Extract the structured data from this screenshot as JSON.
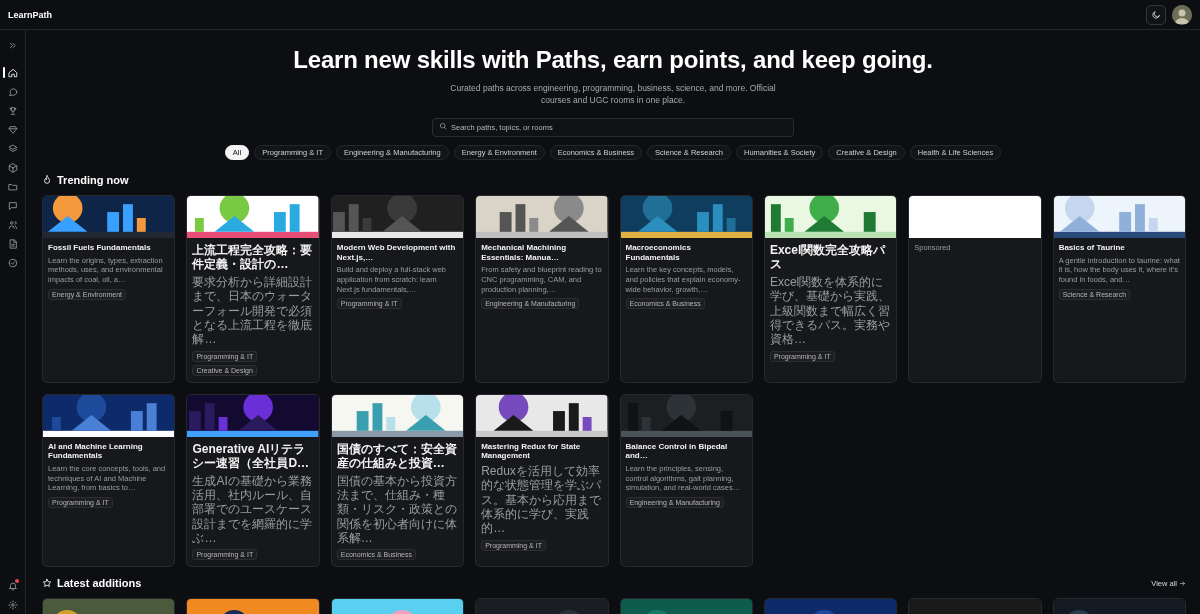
{
  "header": {
    "logo": "LearnPath"
  },
  "sidebar": {
    "items": [
      {
        "selected": true
      },
      {
        "selected": false
      },
      {
        "selected": false
      },
      {
        "selected": false
      },
      {
        "selected": false
      },
      {
        "selected": false
      },
      {
        "selected": false
      },
      {
        "selected": false
      },
      {
        "selected": false
      },
      {
        "selected": false
      },
      {
        "selected": false
      }
    ],
    "notifications_unread": true
  },
  "hero": {
    "title": "Learn new skills with Paths, earn points, and keep going.",
    "subtitle": "Curated paths across engineering, programming, business, science, and more. Official courses and UGC rooms in one place.",
    "search": {
      "placeholder": "Search paths, topics, or rooms"
    }
  },
  "filters": [
    {
      "label": "All",
      "selected": true
    },
    {
      "label": "Programming & IT",
      "selected": false
    },
    {
      "label": "Engineering & Manufacturing",
      "selected": false
    },
    {
      "label": "Energy & Environment",
      "selected": false
    },
    {
      "label": "Economics & Business",
      "selected": false
    },
    {
      "label": "Science & Research",
      "selected": false
    },
    {
      "label": "Humanities & Society",
      "selected": false
    },
    {
      "label": "Creative & Design",
      "selected": false
    },
    {
      "label": "Health & Life Sciences",
      "selected": false
    }
  ],
  "trending": {
    "title": "Trending now",
    "cards": [
      {
        "kind": "path",
        "title": "Fossil Fuels Fundamentals",
        "description": "Learn the origins, types, extraction methods, uses, and environmental impacts of coal, oil, a…",
        "tags": [
          "Energy & Environment"
        ]
      },
      {
        "kind": "path",
        "title": "上流工程完全攻略：要件定義・設計の…",
        "description": "要求分析から詳細設計まで、日本のウォーターフォール開発で必須となる上流工程を徹底解…",
        "tags": [
          "Programming & IT",
          "Creative & Design"
        ]
      },
      {
        "kind": "path",
        "title": "Modern Web Development with Next.js,…",
        "description": "Build and deploy a full-stack web application from scratch: learn Next.js fundamentals,…",
        "tags": [
          "Programming & IT"
        ]
      },
      {
        "kind": "path",
        "title": "Mechanical Machining Essentials: Manua…",
        "description": "From safety and blueprint reading to CNC programming, CAM, and production planning,…",
        "tags": [
          "Engineering & Manufacturing"
        ]
      },
      {
        "kind": "path",
        "title": "Macroeconomics Fundamentals",
        "description": "Learn the key concepts, models, and policies that explain economy-wide behavior, growth,…",
        "tags": [
          "Economics & Business"
        ]
      },
      {
        "kind": "path",
        "title": "Excel関数完全攻略パス",
        "description": "Excel関数を体系的に学び、基礎から実践、上級関数まで幅広く習得できるパス。実務や資格…",
        "tags": [
          "Programming & IT"
        ]
      },
      {
        "kind": "sponsored",
        "label": "Sponsored"
      },
      {
        "kind": "path",
        "title": "Basics of Taurine",
        "description": "A gentle introduction to taurine: what it is, how the body uses it, where it's found in foods, and…",
        "tags": [
          "Science & Research"
        ]
      },
      {
        "kind": "path",
        "title": "AI and Machine Learning Fundamentals",
        "description": "Learn the core concepts, tools, and techniques of AI and Machine Learning, from basics to…",
        "tags": [
          "Programming & IT"
        ]
      },
      {
        "kind": "path",
        "title": "Generative AIリテラシー速習（全社員D…",
        "description": "生成AIの基礎から業務活用、社内ルール、自部署でのユースケース設計までを網羅的に学ぶ…",
        "tags": [
          "Programming & IT"
        ]
      },
      {
        "kind": "path",
        "title": "国債のすべて：安全資産の仕組みと投資…",
        "description": "国債の基本から投資方法まで、仕組み・種類・リスク・政策との関係を初心者向けに体系解…",
        "tags": [
          "Economics & Business"
        ]
      },
      {
        "kind": "path",
        "title": "Mastering Redux for State Management",
        "description": "Reduxを活用して効率的な状態管理を学ぶパス。基本から応用まで体系的に学び、実践的…",
        "tags": [
          "Programming & IT"
        ]
      },
      {
        "kind": "path",
        "title": "Balance Control in Bipedal and…",
        "description": "Learn the principles, sensing, control algorithms, gait planning, simulation, and real-world cases…",
        "tags": [
          "Engineering & Manufacturing"
        ]
      }
    ]
  },
  "latest": {
    "title": "Latest additions",
    "link": "View all",
    "cards": [
      {
        "kind": "picture"
      },
      {
        "kind": "picture"
      },
      {
        "kind": "picture"
      },
      {
        "kind": "picture"
      },
      {
        "kind": "picture"
      },
      {
        "kind": "picture"
      },
      {
        "kind": "blank"
      },
      {
        "kind": "picture"
      }
    ]
  }
}
